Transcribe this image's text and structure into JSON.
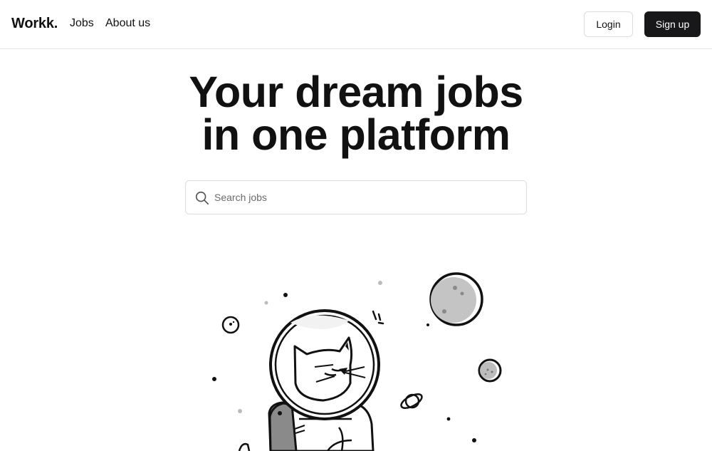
{
  "navbar": {
    "brand": "Workk.",
    "links": [
      {
        "label": "Jobs"
      },
      {
        "label": "About us"
      }
    ],
    "login_label": "Login",
    "signup_label": "Sign up"
  },
  "hero": {
    "title_line1": "Your dream jobs",
    "title_line2": "in one platform"
  },
  "search": {
    "placeholder": "Search jobs",
    "value": "",
    "icon": "search-icon"
  },
  "illustration": {
    "icon": "astronaut-cat-illustration"
  },
  "colors": {
    "primary_button": "#18181b",
    "border": "#dcdcdc",
    "text": "#111111"
  }
}
